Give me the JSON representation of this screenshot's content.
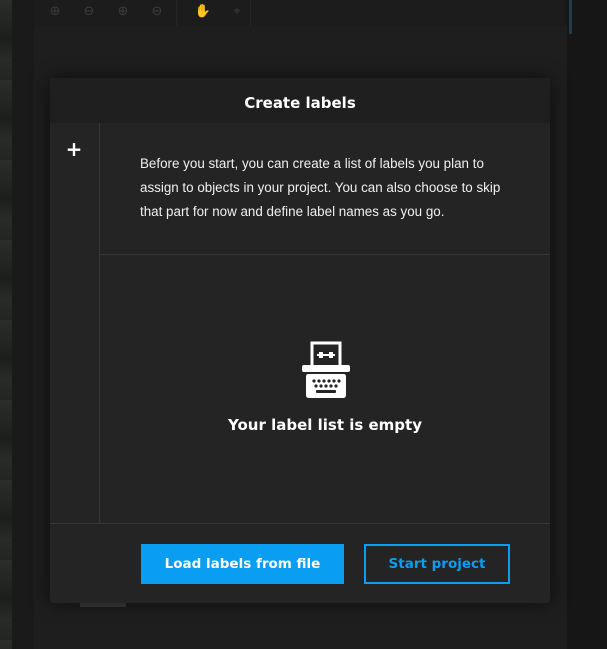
{
  "background": {
    "toolbar_icons": [
      "zoom-in-icon",
      "zoom-out-icon",
      "zoom-fit-icon",
      "zoom-reset-icon",
      "hand-icon",
      "crosshair-icon"
    ]
  },
  "modal": {
    "title": "Create labels",
    "add_icon": "+",
    "intro_text": "Before you start, you can create a list of labels you plan to assign to objects in your project. You can also choose to skip that part for now and define label names as you go.",
    "empty_icon": "typewriter-icon",
    "empty_text": "Your label list is empty",
    "buttons": {
      "load": "Load labels from file",
      "start": "Start project"
    }
  },
  "colors": {
    "accent": "#0a9ef3",
    "modal_bg": "#242424",
    "header_bg": "#1f1f1f",
    "text": "#ffffff"
  }
}
